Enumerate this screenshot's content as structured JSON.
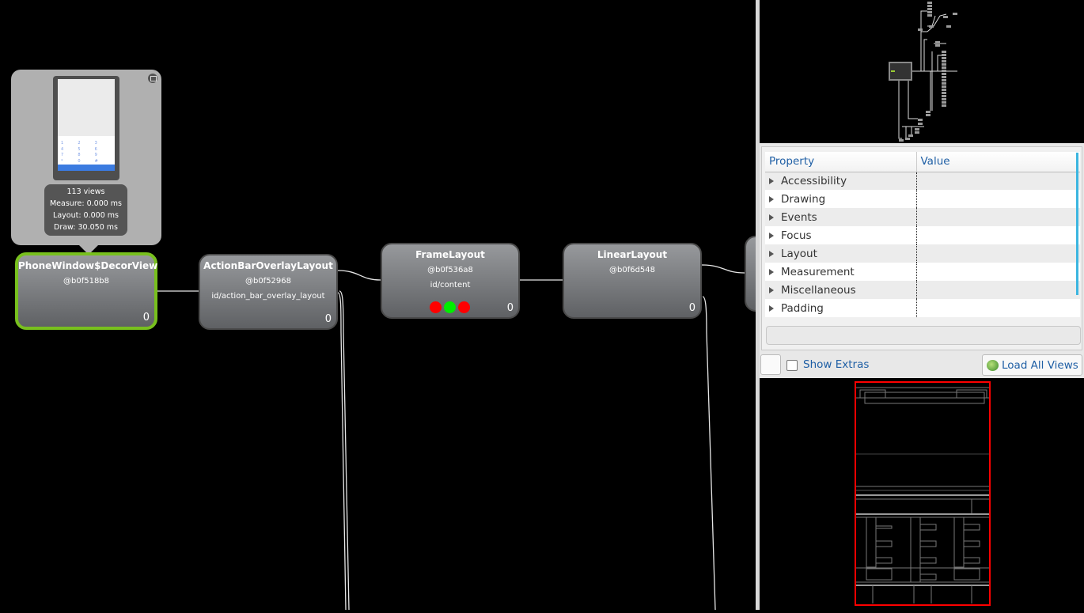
{
  "tree": {
    "nodes": [
      {
        "name": "PhoneWindow$DecorView",
        "address": "@b0f518b8",
        "id": "",
        "count": "0",
        "selected": true
      },
      {
        "name": "ActionBarOverlayLayout",
        "address": "@b0f52968",
        "id": "id/action_bar_overlay_layout",
        "count": "0"
      },
      {
        "name": "FrameLayout",
        "address": "@b0f536a8",
        "id": "id/content",
        "count": "0",
        "indicators": [
          "#ff0000",
          "#00ee00",
          "#ff0000"
        ]
      },
      {
        "name": "LinearLayout",
        "address": "@b0f6d548",
        "id": "",
        "count": "0"
      }
    ],
    "popup": {
      "views": "113 views",
      "measure": "Measure: 0.000 ms",
      "layout": "Layout: 0.000 ms",
      "draw": "Draw: 30.050 ms",
      "keys": [
        "1",
        "2",
        "3",
        "4",
        "5",
        "6",
        "7",
        "8",
        "9",
        "*",
        "0",
        "#"
      ]
    }
  },
  "properties": {
    "headers": [
      "Property",
      "Value"
    ],
    "rows": [
      "Accessibility",
      "Drawing",
      "Events",
      "Focus",
      "Layout",
      "Measurement",
      "Miscellaneous",
      "Padding"
    ]
  },
  "toolbar": {
    "show_extras": "Show Extras",
    "show_extras_checked": false,
    "load_all": "Load All Views"
  },
  "colors": {
    "selected_border": "#78c01e",
    "wireframe_outline": "#ff0000",
    "accent": "#1f5fa5"
  }
}
